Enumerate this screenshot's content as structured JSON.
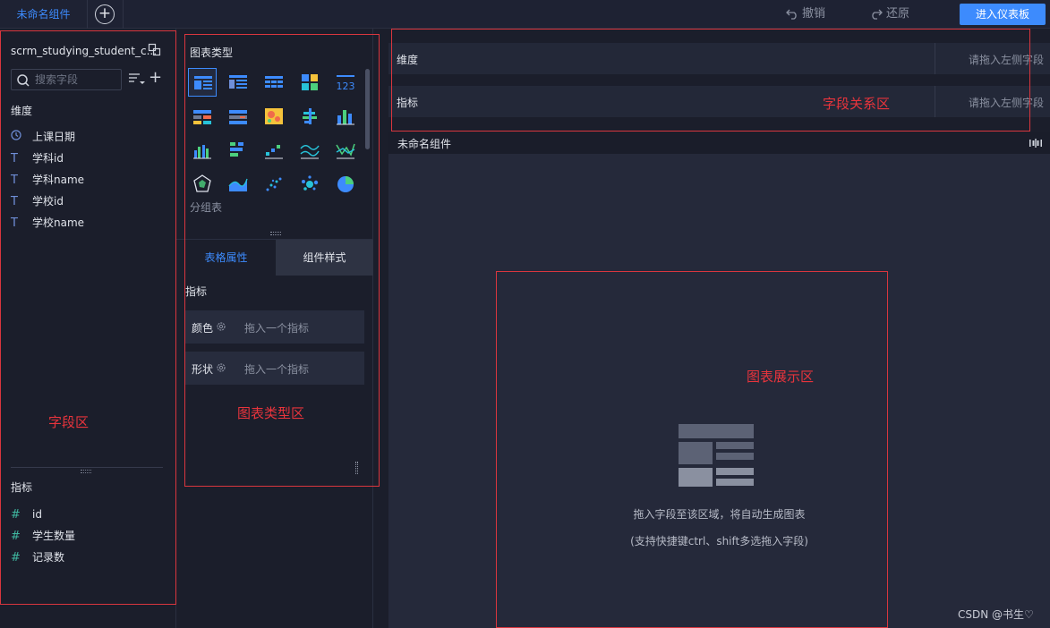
{
  "topbar": {
    "tab_active": "未命名组件",
    "add_tab": "+",
    "undo_label": "撤销",
    "redo_label": "还原",
    "enter_dashboard_label": "进入仪表板"
  },
  "field_panel": {
    "dataset_name": "scrm_studying_student_c...",
    "search_placeholder": "搜索字段",
    "dimension_title": "维度",
    "dimensions": [
      {
        "icon": "clock-icon",
        "label": "上课日期"
      },
      {
        "icon": "text-type-icon",
        "label": "学科id"
      },
      {
        "icon": "text-type-icon",
        "label": "学科name"
      },
      {
        "icon": "text-type-icon",
        "label": "学校id"
      },
      {
        "icon": "text-type-icon",
        "label": "学校name"
      }
    ],
    "measure_title": "指标",
    "measures": [
      {
        "icon": "number-type-icon",
        "label": "id"
      },
      {
        "icon": "number-type-icon",
        "label": "学生数量"
      },
      {
        "icon": "number-type-icon",
        "label": "记录数"
      }
    ]
  },
  "chart_panel": {
    "title": "图表类型",
    "chart_types": [
      "grouped-table-icon",
      "detail-table-icon",
      "cross-table-icon",
      "color-block-icon",
      "kpi-number-icon",
      "heat-table-icon",
      "custom-table-icon",
      "heatmap-icon",
      "stacked-bar-icon",
      "column-chart-icon",
      "multi-column-icon",
      "bar-chart-icon",
      "step-bar-icon",
      "area-line-icon",
      "line-chart-icon",
      "radar-icon",
      "area-chart-icon",
      "scatter-icon",
      "bubble-icon",
      "pie-chart-icon"
    ],
    "selected_caption": "分组表",
    "tab_table_attr": "表格属性",
    "tab_component_style": "组件样式",
    "attr_title": "指标",
    "attr_rows": [
      {
        "label": "颜色",
        "placeholder": "拖入一个指标"
      },
      {
        "label": "形状",
        "placeholder": "拖入一个指标"
      }
    ]
  },
  "main": {
    "relation_rows": [
      {
        "label": "维度",
        "hint": "请拖入左侧字段"
      },
      {
        "label": "指标",
        "hint": "请拖入左侧字段"
      }
    ],
    "component_title": "未命名组件",
    "empty_text_1": "拖入字段至该区域，将自动生成图表",
    "empty_text_2": "(支持快捷键ctrl、shift多选拖入字段)"
  },
  "annotations": {
    "field_area": "字段区",
    "chart_type_area": "图表类型区",
    "relation_area": "字段关系区",
    "display_area": "图表展示区"
  },
  "watermark": "CSDN @书生♡",
  "colors": {
    "accent": "#3d8bfd",
    "annotation_red": "#d9363e",
    "background": "#1b1e2b"
  }
}
